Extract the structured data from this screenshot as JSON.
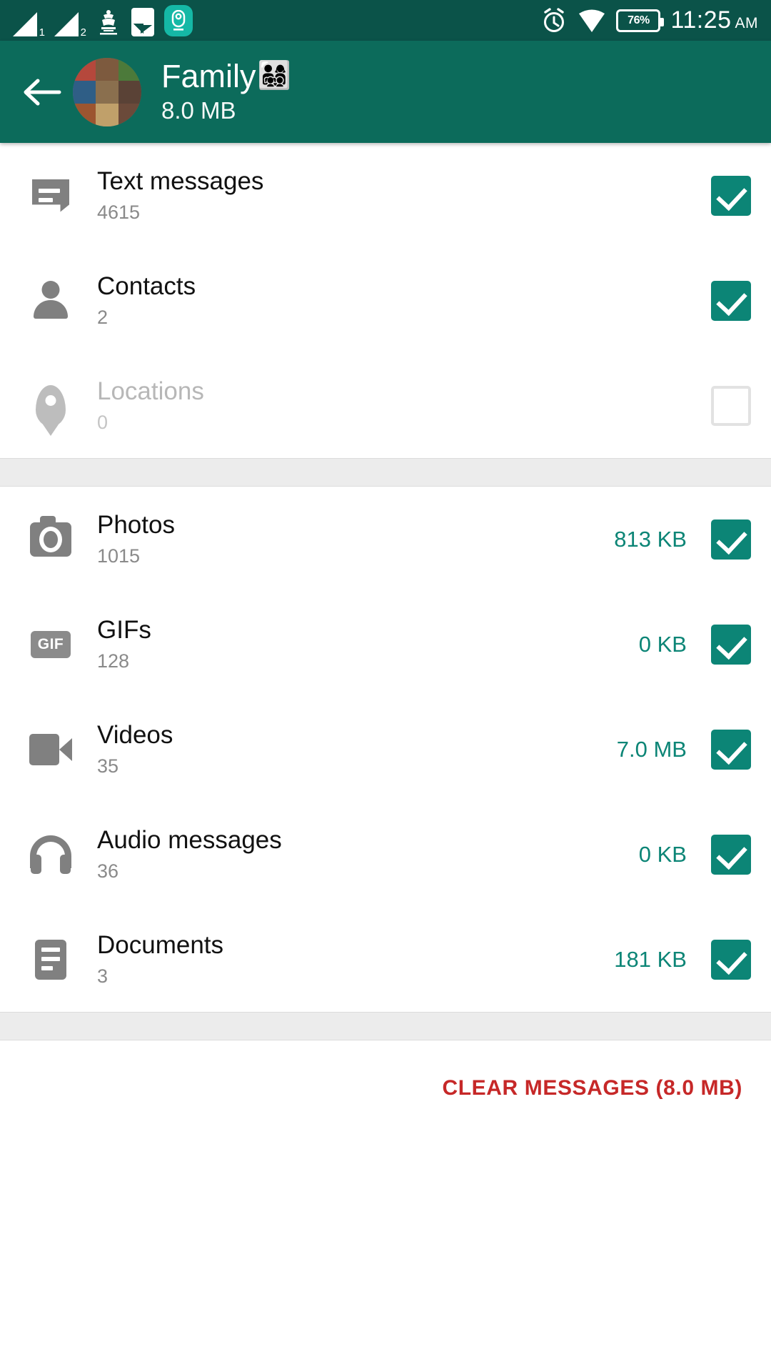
{
  "statusbar": {
    "sim1_label": "1",
    "sim2_label": "2",
    "battery_percent": "76%",
    "time": "11:25",
    "meridiem": "AM",
    "icons": [
      "signal-bars-sim1",
      "signal-bars-sim2",
      "government-emblem-icon",
      "gallery-icon",
      "app-notification-badge-icon",
      "alarm-icon",
      "wifi-icon",
      "battery-icon"
    ]
  },
  "appbar": {
    "back_label": "←",
    "title": "Family",
    "title_emoji": "👨‍👩‍👧‍👦",
    "subtitle": "8.0 MB",
    "bg_color": "#0c6b5b"
  },
  "colors": {
    "accent": "#0c8576",
    "danger": "#c62828",
    "status_bar": "#0b5349"
  },
  "sections": [
    {
      "name": "messages-section",
      "rows": [
        {
          "icon": "text-message-icon",
          "label": "Text messages",
          "count": "4615",
          "size": "",
          "checked": true,
          "disabled": false
        },
        {
          "icon": "contact-person-icon",
          "label": "Contacts",
          "count": "2",
          "size": "",
          "checked": true,
          "disabled": false
        },
        {
          "icon": "location-pin-icon",
          "label": "Locations",
          "count": "0",
          "size": "",
          "checked": false,
          "disabled": true
        }
      ]
    },
    {
      "name": "media-section",
      "rows": [
        {
          "icon": "camera-icon",
          "label": "Photos",
          "count": "1015",
          "size": "813 KB",
          "checked": true,
          "disabled": false
        },
        {
          "icon": "gif-icon",
          "label": "GIFs",
          "count": "128",
          "size": "0 KB",
          "checked": true,
          "disabled": false
        },
        {
          "icon": "video-camera-icon",
          "label": "Videos",
          "count": "35",
          "size": "7.0 MB",
          "checked": true,
          "disabled": false
        },
        {
          "icon": "headphones-icon",
          "label": "Audio messages",
          "count": "36",
          "size": "0 KB",
          "checked": true,
          "disabled": false
        },
        {
          "icon": "document-icon",
          "label": "Documents",
          "count": "3",
          "size": "181 KB",
          "checked": true,
          "disabled": false
        }
      ]
    }
  ],
  "footer": {
    "clear_label": "CLEAR MESSAGES (8.0 MB)"
  }
}
